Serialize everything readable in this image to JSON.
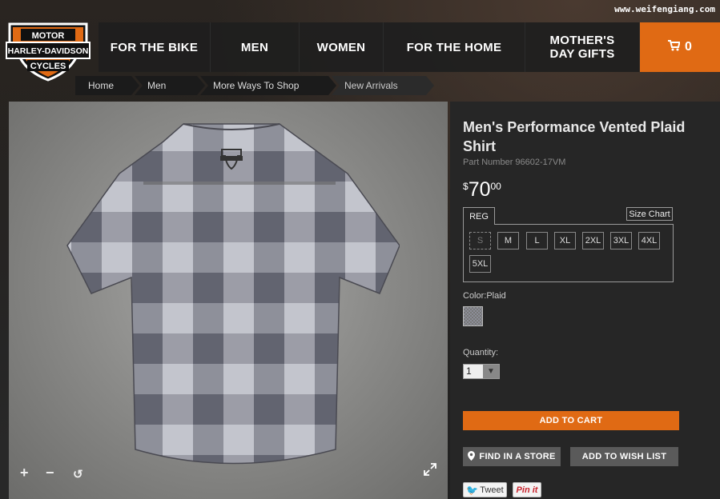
{
  "watermark": "www.weifengiang.com",
  "logo": {
    "top_text": "MOTOR",
    "middle_text": "HARLEY-DAVIDSON",
    "bottom_text": "CYCLES",
    "colors": {
      "orange": "#e06a14",
      "black": "#111111",
      "white": "#ffffff"
    }
  },
  "nav": {
    "items": [
      {
        "label": "FOR THE BIKE"
      },
      {
        "label": "MEN"
      },
      {
        "label": "WOMEN"
      },
      {
        "label": "FOR THE HOME"
      },
      {
        "label": "MOTHER'S\nDAY GIFTS"
      }
    ],
    "cart": {
      "icon": "cart-icon",
      "count": "0"
    }
  },
  "breadcrumb": [
    {
      "label": "Home"
    },
    {
      "label": "Men"
    },
    {
      "label": "More Ways To Shop"
    },
    {
      "label": "New Arrivals"
    }
  ],
  "gallery": {
    "controls": {
      "zoom_in": "+",
      "zoom_out": "−",
      "reset": "↺",
      "fullscreen": "expand-icon"
    }
  },
  "product": {
    "title": "Men's Performance Vented Plaid Shirt",
    "part_label": "Part Number",
    "part_number": "96602-17VM",
    "price_symbol": "$",
    "price_whole": "70",
    "price_cents": "00",
    "fit_tab": "REG",
    "size_chart_label": "Size Chart",
    "sizes": [
      {
        "label": "S",
        "available": false
      },
      {
        "label": "M",
        "available": true
      },
      {
        "label": "L",
        "available": true
      },
      {
        "label": "XL",
        "available": true
      },
      {
        "label": "2XL",
        "available": true
      },
      {
        "label": "3XL",
        "available": true
      },
      {
        "label": "4XL",
        "available": true
      },
      {
        "label": "5XL",
        "available": true
      }
    ],
    "color_label": "Color:Plaid",
    "quantity_label": "Quantity:",
    "quantity_value": "1",
    "add_to_cart_label": "ADD TO CART",
    "find_store_label": "FIND IN A STORE",
    "wish_list_label": "ADD TO WISH LIST",
    "tweet_label": "Tweet",
    "pin_label": "Pin it"
  },
  "accent_color": "#e06a14"
}
